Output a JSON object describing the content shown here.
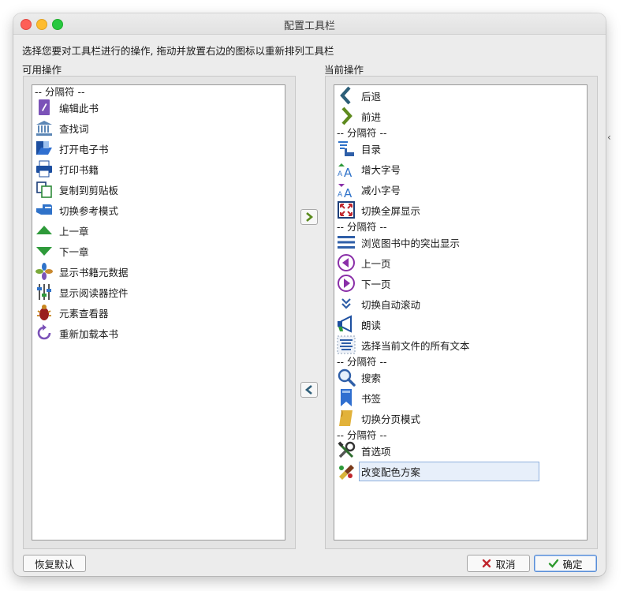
{
  "window": {
    "title": "配置工具栏"
  },
  "instructions": "选择您要对工具栏进行的操作, 拖动并放置右边的图标以重新排列工具栏",
  "available": {
    "label": "可用操作",
    "items": [
      {
        "type": "separator",
        "label": "-- 分隔符 --"
      },
      {
        "type": "action",
        "label": "编辑此书",
        "icon": "edit-book-icon"
      },
      {
        "type": "action",
        "label": "查找词",
        "icon": "lookup-word-icon"
      },
      {
        "type": "action",
        "label": "打开电子书",
        "icon": "open-ebook-icon"
      },
      {
        "type": "action",
        "label": "打印书籍",
        "icon": "print-icon"
      },
      {
        "type": "action",
        "label": "复制到剪贴板",
        "icon": "copy-icon"
      },
      {
        "type": "action",
        "label": "切换参考模式",
        "icon": "reference-mode-icon"
      },
      {
        "type": "action",
        "label": "上一章",
        "icon": "previous-chapter-icon"
      },
      {
        "type": "action",
        "label": "下一章",
        "icon": "next-chapter-icon"
      },
      {
        "type": "action",
        "label": "显示书籍元数据",
        "icon": "metadata-icon"
      },
      {
        "type": "action",
        "label": "显示阅读器控件",
        "icon": "reader-controls-icon"
      },
      {
        "type": "action",
        "label": "元素查看器",
        "icon": "inspector-bug-icon"
      },
      {
        "type": "action",
        "label": "重新加载本书",
        "icon": "reload-icon"
      }
    ]
  },
  "current": {
    "label": "当前操作",
    "items": [
      {
        "type": "action",
        "label": "后退",
        "icon": "back-icon"
      },
      {
        "type": "action",
        "label": "前进",
        "icon": "forward-icon"
      },
      {
        "type": "separator",
        "label": "-- 分隔符 --"
      },
      {
        "type": "action",
        "label": "目录",
        "icon": "toc-icon"
      },
      {
        "type": "action",
        "label": "增大字号",
        "icon": "font-larger-icon"
      },
      {
        "type": "action",
        "label": "减小字号",
        "icon": "font-smaller-icon"
      },
      {
        "type": "action",
        "label": "切换全屏显示",
        "icon": "fullscreen-icon"
      },
      {
        "type": "separator",
        "label": "-- 分隔符 --"
      },
      {
        "type": "action",
        "label": "浏览图书中的突出显示",
        "icon": "highlights-icon"
      },
      {
        "type": "action",
        "label": "上一页",
        "icon": "previous-page-icon"
      },
      {
        "type": "action",
        "label": "下一页",
        "icon": "next-page-icon"
      },
      {
        "type": "action",
        "label": "切换自动滚动",
        "icon": "autoscroll-icon"
      },
      {
        "type": "action",
        "label": "朗读",
        "icon": "read-aloud-icon"
      },
      {
        "type": "action",
        "label": "选择当前文件的所有文本",
        "icon": "select-all-icon"
      },
      {
        "type": "separator",
        "label": "-- 分隔符 --"
      },
      {
        "type": "action",
        "label": "搜索",
        "icon": "search-icon"
      },
      {
        "type": "action",
        "label": "书签",
        "icon": "bookmark-icon"
      },
      {
        "type": "action",
        "label": "切换分页模式",
        "icon": "paged-mode-icon"
      },
      {
        "type": "separator",
        "label": "-- 分隔符 --"
      },
      {
        "type": "action",
        "label": "首选项",
        "icon": "preferences-icon"
      },
      {
        "type": "action",
        "label": "改变配色方案",
        "icon": "color-scheme-icon",
        "selected": true
      }
    ]
  },
  "buttons": {
    "restore": "恢复默认",
    "cancel": "取消",
    "ok": "确定"
  },
  "colors": {
    "selection": "#e7effa",
    "accent": "#5a8ed6"
  }
}
